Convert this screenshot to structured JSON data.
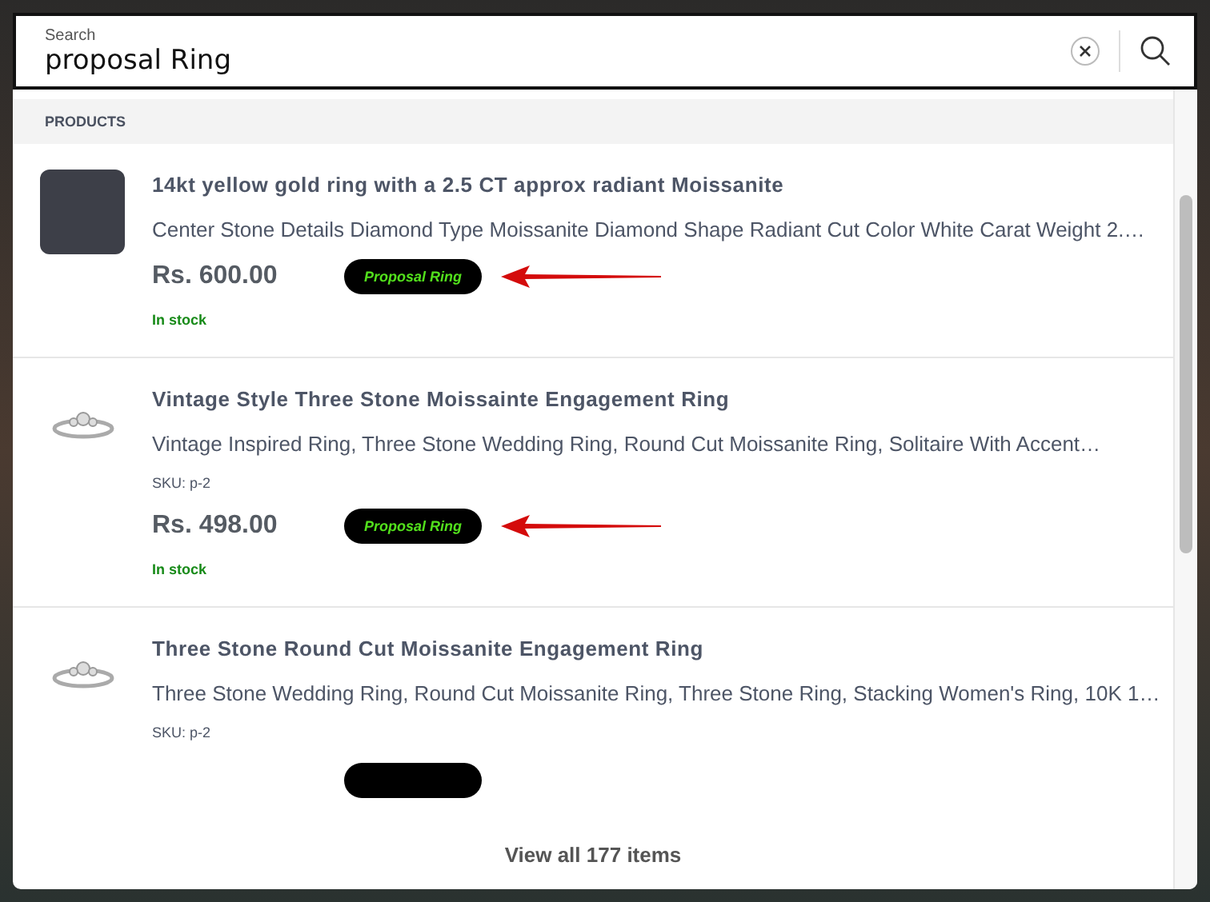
{
  "search": {
    "label": "Search",
    "value": "proposal Ring"
  },
  "section_header": "PRODUCTS",
  "products": [
    {
      "kind": "dark",
      "title": "14kt yellow gold ring with a 2.5 CT approx radiant Moissanite",
      "description": "Center Stone Details Diamond Type Moissanite Diamond Shape Radiant Cut Color White Carat Weight 2.…",
      "price": "Rs. 600.00",
      "tag": "Proposal Ring",
      "arrow": true,
      "stock": "In stock"
    },
    {
      "kind": "light",
      "title": "Vintage Style Three Stone Moissainte Engagement Ring",
      "description": "Vintage Inspired Ring, Three Stone Wedding Ring, Round Cut Moissanite Ring, Solitaire With Accent…",
      "sku": "SKU: p-2",
      "price": "Rs. 498.00",
      "tag": "Proposal Ring",
      "arrow": true,
      "stock": "In stock"
    },
    {
      "kind": "light",
      "title": "Three Stone Round Cut Moissanite Engagement Ring",
      "description": "Three Stone Wedding Ring, Round Cut Moissanite Ring, Three Stone Ring, Stacking Women's Ring, 10K 1…",
      "sku": "SKU: p-2",
      "arrow": false
    }
  ],
  "footer_link": "View all 177 items"
}
